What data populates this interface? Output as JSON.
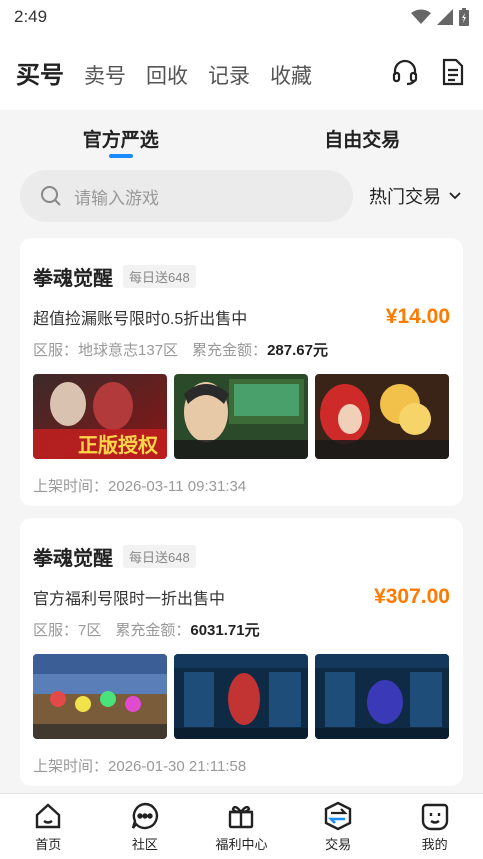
{
  "status": {
    "time": "2:49"
  },
  "topbar": {
    "tabs": [
      {
        "label": "买号",
        "active": true
      },
      {
        "label": "卖号",
        "active": false
      },
      {
        "label": "回收",
        "active": false
      },
      {
        "label": "记录",
        "active": false
      },
      {
        "label": "收藏",
        "active": false
      }
    ]
  },
  "segment": {
    "official": "官方严选",
    "free": "自由交易"
  },
  "search": {
    "placeholder": "请输入游戏",
    "filter_label": "热门交易"
  },
  "listings": [
    {
      "game": "拳魂觉醒",
      "tag": "每日送648",
      "description": "超值捡漏账号限时0.5折出售中",
      "price": "¥14.00",
      "server_label": "区服：",
      "server": "地球意志137区",
      "recharge_label": "累充金额：",
      "recharge": "287.67元",
      "listed_label": "上架时间：",
      "listed_time": "2026-03-11 09:31:34"
    },
    {
      "game": "拳魂觉醒",
      "tag": "每日送648",
      "description": "官方福利号限时一折出售中",
      "price": "¥307.00",
      "server_label": "区服：",
      "server": "7区",
      "recharge_label": "累充金额：",
      "recharge": "6031.71元",
      "listed_label": "上架时间：",
      "listed_time": "2026-01-30 21:11:58"
    }
  ],
  "bottom_nav": [
    {
      "label": "首页",
      "icon": "home-icon"
    },
    {
      "label": "社区",
      "icon": "community-icon"
    },
    {
      "label": "福利中心",
      "icon": "gift-icon"
    },
    {
      "label": "交易",
      "icon": "trade-icon"
    },
    {
      "label": "我的",
      "icon": "profile-icon"
    }
  ],
  "colors": {
    "accent": "#1a8cff",
    "price": "#ff7a00"
  }
}
